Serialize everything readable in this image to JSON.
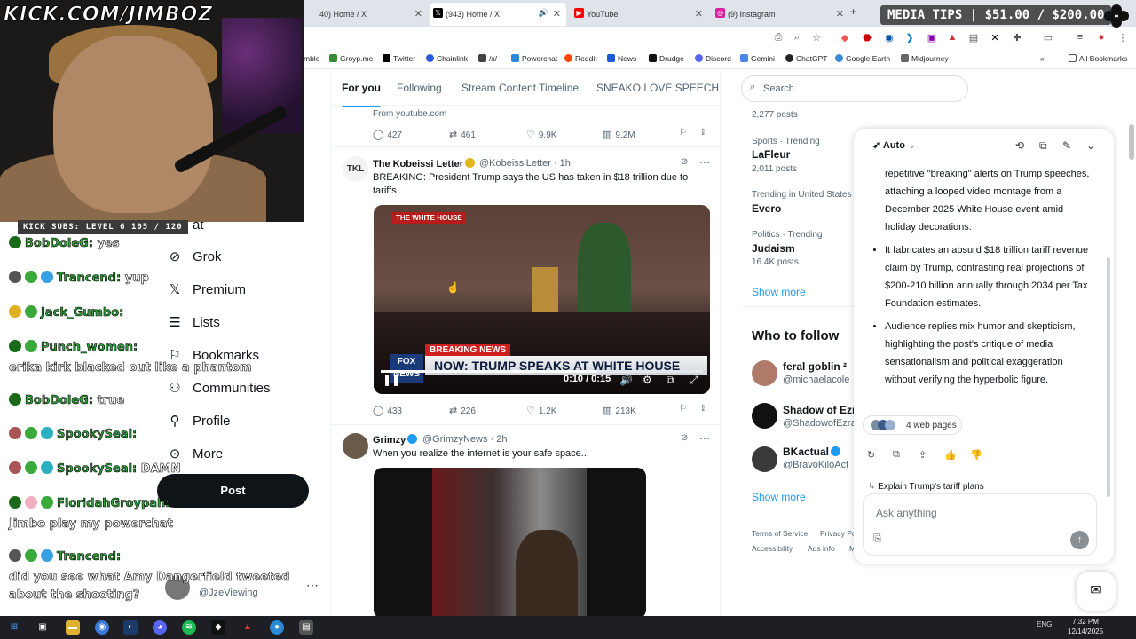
{
  "browser": {
    "tabs": [
      {
        "label": "40) Home / X",
        "icon": "x-icon"
      },
      {
        "label": "(943) Home / X",
        "icon": "x-icon",
        "active": true
      },
      {
        "label": "YouTube",
        "icon": "youtube-icon"
      },
      {
        "label": "(9) Instagram",
        "icon": "instagram-icon"
      }
    ],
    "new_tab": "+",
    "bookmarks": [
      "mble",
      "Groyp.me",
      "Twitter",
      "Chainlink",
      "/x/",
      "Powerchat",
      "Reddit",
      "News",
      "Drudge",
      "Discord",
      "Gemini",
      "ChatGPT",
      "Google Earth",
      "Midjourney"
    ],
    "all_bookmarks": "All Bookmarks",
    "overflow": "»"
  },
  "stream": {
    "handle": "KICK.COM/JIMBOZ",
    "subs_bar": "KICK SUBS: LEVEL 6 105 / 120",
    "media_tips": "MEDIA TIPS | $51.00 / $200.00",
    "chat": [
      {
        "user": "BobDoleG:",
        "msg": "yes"
      },
      {
        "user": "Trancend:",
        "msg": "yup"
      },
      {
        "user": "Jack_Gumbo:",
        "msg": ""
      },
      {
        "user": "Punch_women:",
        "msg": ""
      },
      {
        "user": "",
        "msg": "erika kirk blacked out like a phantom"
      },
      {
        "user": "BobDoleG:",
        "msg": "true"
      },
      {
        "user": "SpookySeal:",
        "msg": ""
      },
      {
        "user": "SpookySeal:",
        "msg": "DAMN"
      },
      {
        "user": "FloridahGroypah:",
        "msg": ""
      },
      {
        "user": "",
        "msg": "Jimbo play my powerchat"
      },
      {
        "user": "Trancend:",
        "msg": ""
      },
      {
        "user": "",
        "msg": "did you see what Amy Dangerfield tweeted"
      },
      {
        "user": "",
        "msg": "about the shooting?"
      }
    ]
  },
  "x_nav": {
    "partial": "at",
    "items": [
      {
        "label": "Grok",
        "icon": "grok-icon"
      },
      {
        "label": "Premium",
        "icon": "x-icon"
      },
      {
        "label": "Lists",
        "icon": "list-icon"
      },
      {
        "label": "Bookmarks",
        "icon": "bookmark-icon"
      },
      {
        "label": "Communities",
        "icon": "communities-icon"
      },
      {
        "label": "Profile",
        "icon": "profile-icon"
      },
      {
        "label": "More",
        "icon": "more-icon"
      }
    ],
    "post_label": "Post",
    "account_handle": "@JzeViewing",
    "account_more": "⋯"
  },
  "feed": {
    "tabs": [
      "For you",
      "Following",
      "Stream Content Timeline",
      "SNEAKO LOVE SPEECH"
    ],
    "prev_tweet": {
      "source": "From youtube.com",
      "replies": "427",
      "reposts": "461",
      "likes": "9.9K",
      "views": "9.2M"
    },
    "tweet1": {
      "name": "The Kobeissi Letter",
      "handle": "@KobeissiLetter · 1h",
      "avatar_text": "TKL",
      "text": "BREAKING: President Trump says the US has taken in $18 trillion due to tariffs.",
      "video": {
        "logo": "THE WHITE HOUSE",
        "breaking": "BREAKING NEWS",
        "headline": "NOW: TRUMP SPEAKS AT WHITE HOUSE",
        "network": "FOX NEWS",
        "time": "0:10 / 0:15",
        "progress": 0.67
      },
      "replies": "433",
      "reposts": "226",
      "likes": "1.2K",
      "views": "213K"
    },
    "tweet2": {
      "name": "Grimzy",
      "handle": "@GrimzyNews · 2h",
      "text": "When you realize the internet is your safe space..."
    }
  },
  "right": {
    "search_placeholder": "Search",
    "trend_top_posts": "2,277 posts",
    "trends": [
      {
        "context": "Sports · Trending",
        "name": "LaFleur",
        "posts": "2,011 posts"
      },
      {
        "context": "Trending in United States",
        "name": "Evero",
        "posts": ""
      },
      {
        "context": "Politics · Trending",
        "name": "Judaism",
        "posts": "16.4K posts"
      }
    ],
    "show_more": "Show more",
    "who_to_follow": "Who to follow",
    "follow": [
      {
        "name": "feral goblin ²",
        "handle": "@michaelacole"
      },
      {
        "name": "Shadow of Ezra",
        "handle": "@ShadowofEzra"
      },
      {
        "name": "BKactual",
        "handle": "@BravoKiloAct"
      }
    ],
    "show_more2": "Show more",
    "footer": [
      "Terms of Service",
      "Privacy Po",
      "Accessibility",
      "Ads info",
      "M"
    ]
  },
  "grok": {
    "mode": "Auto",
    "intro": "repetitive \"breaking\" alerts on Trump speeches, attaching a looped video montage from a December 2025 White House event amid holiday decorations.",
    "bullets": [
      "It fabricates an absurd $18 trillion tariff revenue claim by Trump, contrasting real projections of $200-210 billion annually through 2034 per Tax Foundation estimates.",
      "Audience replies mix humor and skepticism, highlighting the post's critique of media sensationalism and political exaggeration without verifying the hyperbolic figure."
    ],
    "sources": "4 web pages",
    "followup": "Explain Trump's tariff plans",
    "ask_placeholder": "Ask anything"
  },
  "taskbar": {
    "tray": "ENG",
    "time": "7:32 PM",
    "date": "12/14/2025"
  },
  "colors": {
    "x_blue": "#1d9bf0",
    "chat_green": "#2fa33a",
    "fox_red": "#d01f1f"
  }
}
